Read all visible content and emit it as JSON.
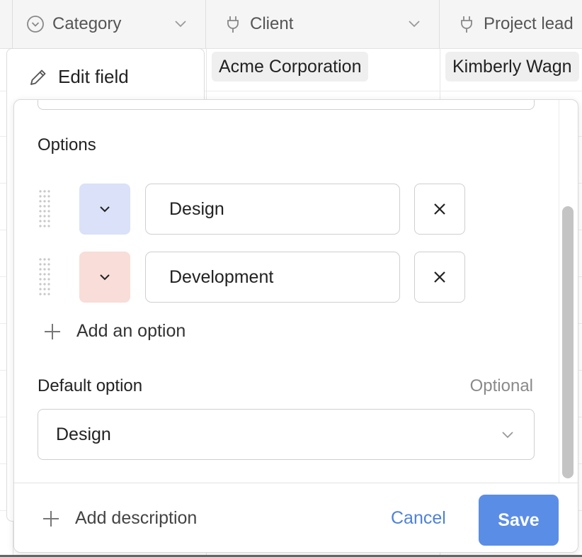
{
  "grid": {
    "columns": [
      {
        "name": "Category",
        "icon": "dropdown-circle-icon"
      },
      {
        "name": "Client",
        "icon": "plug-icon"
      },
      {
        "name": "Project lead",
        "icon": "plug-icon"
      }
    ],
    "first_row": {
      "client": "Acme Corporation",
      "project_lead": "Kimberly Wagn"
    }
  },
  "edit_tab": {
    "label": "Edit field",
    "icon": "pencil-icon"
  },
  "options_section": {
    "title": "Options",
    "items": [
      {
        "label": "Design",
        "color": "#dae1f8"
      },
      {
        "label": "Development",
        "color": "#f8ddd8"
      }
    ],
    "add_label": "Add an option"
  },
  "default_option": {
    "title": "Default option",
    "hint": "Optional",
    "selected": "Design"
  },
  "footer": {
    "add_description": "Add description",
    "cancel": "Cancel",
    "save": "Save"
  },
  "colors": {
    "accent": "#5a8de6",
    "link": "#4e82d8"
  }
}
